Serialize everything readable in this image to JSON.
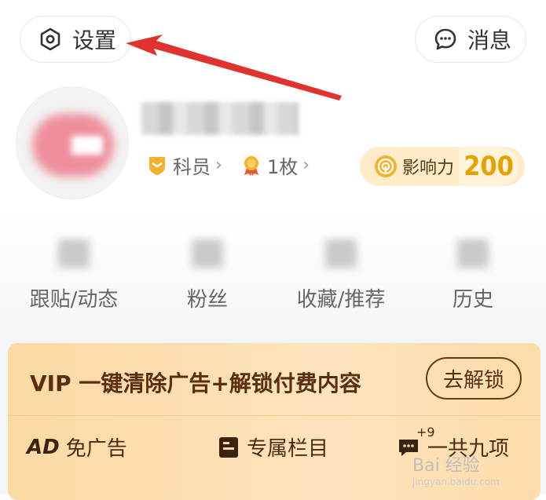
{
  "header": {
    "settings_label": "设置",
    "messages_label": "消息"
  },
  "profile": {
    "rank_label": "科员",
    "medal_label": "1枚",
    "chevron": "›",
    "influence_label": "影响力",
    "influence_value": "200"
  },
  "stats": [
    {
      "label": "跟贴/动态"
    },
    {
      "label": "粉丝"
    },
    {
      "label": "收藏/推荐"
    },
    {
      "label": "历史"
    }
  ],
  "vip": {
    "title": "VIP 一键清除广告+解锁付费内容",
    "unlock_label": "去解锁",
    "perks": [
      {
        "badge": "AD",
        "label": "免广告"
      },
      {
        "label": "专属栏目"
      },
      {
        "sup": "+9",
        "label": "一共九项"
      }
    ]
  },
  "watermark": {
    "brand": "Bai 经验",
    "url": "jingyan.baidu.com"
  },
  "colors": {
    "accent": "#e4a100",
    "vip_text": "#5a2e0f",
    "arrow": "#e0332f"
  },
  "icons": {
    "settings": "hexagon-gear-icon",
    "messages": "chat-bubble-icon",
    "rank": "shield-badge-icon",
    "medal": "medal-icon",
    "influence": "signal-icon",
    "column": "bookmark-doc-icon",
    "nine": "chat-dots-icon"
  }
}
